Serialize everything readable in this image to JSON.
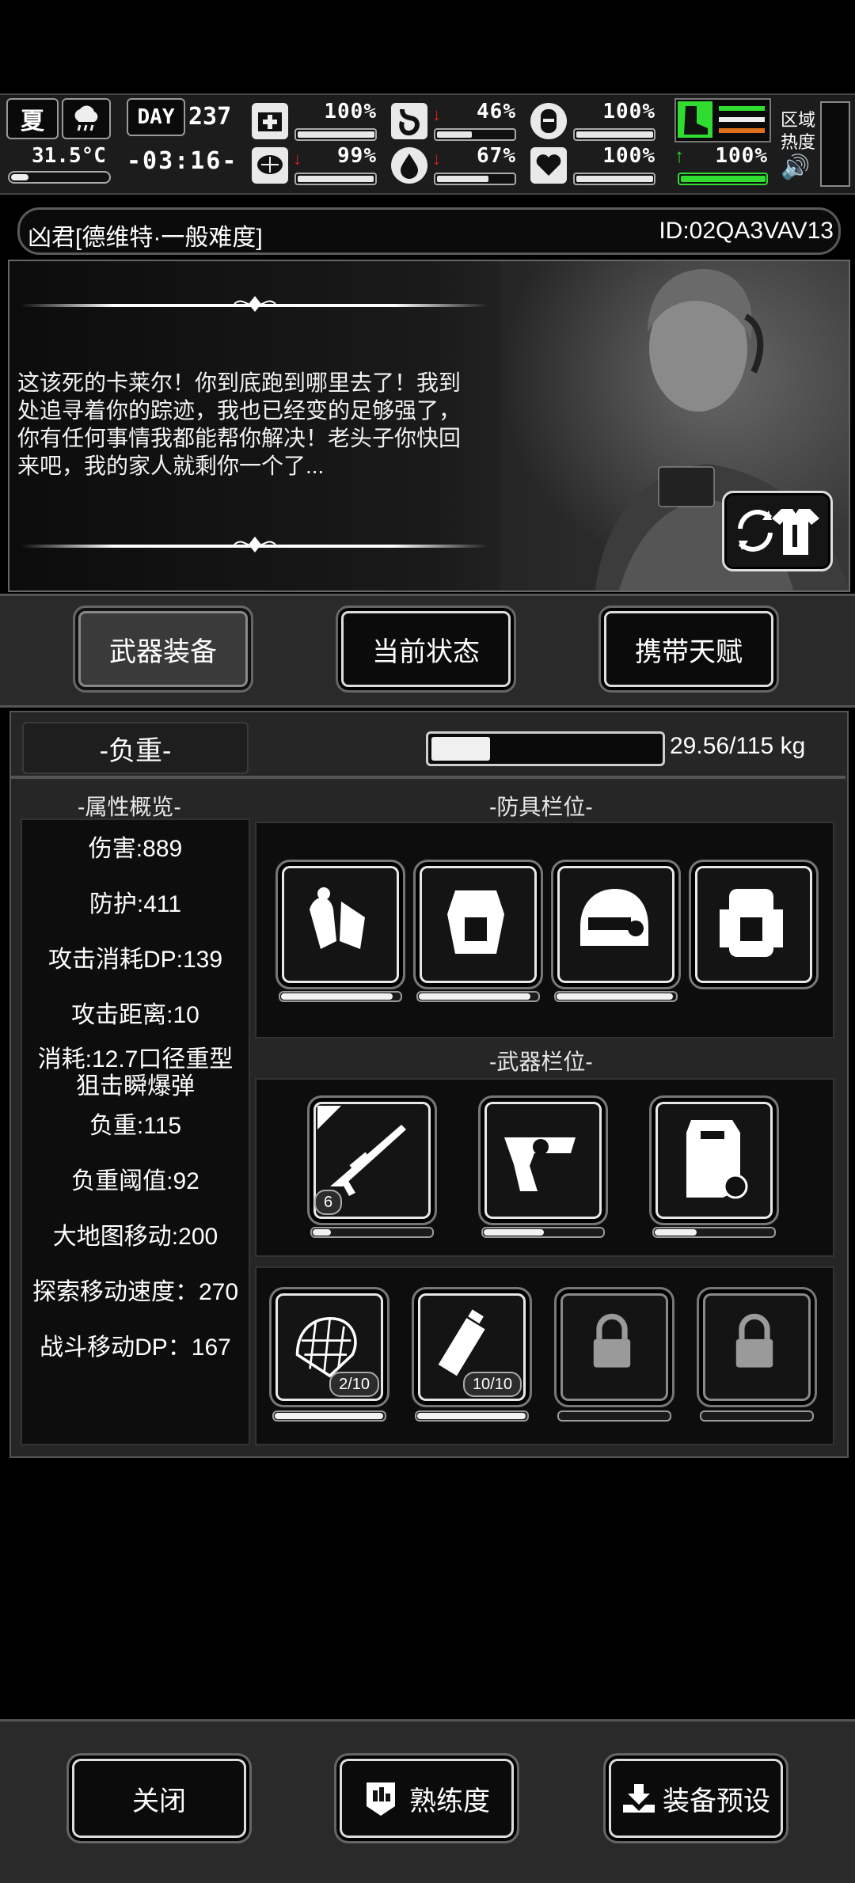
{
  "hud": {
    "season": "夏",
    "day_label": "DAY",
    "day_number": "237",
    "temperature": "31.5°C",
    "time": "-03:16-",
    "stats": [
      {
        "name": "health",
        "value": "100%",
        "percent": 100,
        "arrow": ""
      },
      {
        "name": "hunger",
        "value": "46%",
        "percent": 46,
        "arrow": "down"
      },
      {
        "name": "armor",
        "value": "100%",
        "percent": 100,
        "arrow": ""
      },
      {
        "name": "sanity",
        "value": "99%",
        "percent": 99,
        "arrow": "down"
      },
      {
        "name": "thirst",
        "value": "67%",
        "percent": 67,
        "arrow": "down"
      },
      {
        "name": "heart",
        "value": "100%",
        "percent": 100,
        "arrow": ""
      },
      {
        "name": "stamina",
        "value": "100%",
        "percent": 100,
        "arrow": "up"
      }
    ],
    "region_label_1": "区域",
    "region_label_2": "热度"
  },
  "title": {
    "name": "凶君[德维特·一般难度]",
    "id": "ID:02QA3VAV13"
  },
  "story": {
    "text": "这该死的卡莱尔！你到底跑到哪里去了！我到处追寻着你的踪迹，我也已经变的足够强了，你有任何事情我都能帮你解决！老头子你快回来吧，我的家人就剩你一个了..."
  },
  "tabs": [
    "武器装备",
    "当前状态",
    "携带天赋"
  ],
  "load": {
    "label": "-负重-",
    "text": "29.56/115 kg",
    "fraction": 0.257
  },
  "attributes": {
    "header": "-属性概览-",
    "items": [
      "伤害:889",
      "防护:411",
      "攻击消耗DP:139",
      "攻击距离:10",
      "消耗:12.7口径重型",
      "狙击瞬爆弹",
      "负重:115",
      "负重阈值:92",
      "大地图移动:200",
      "探索移动速度：270",
      "战斗移动DP：167"
    ]
  },
  "armor_slots": {
    "header": "-防具栏位-",
    "items": [
      {
        "icon": "gloves-icon",
        "durability": 0.95
      },
      {
        "icon": "armor-vest-icon",
        "durability": 0.95
      },
      {
        "icon": "helmet-icon",
        "durability": 0.98
      },
      {
        "icon": "backpack-icon",
        "durability": null
      }
    ]
  },
  "weapon_slots": {
    "header": "-武器栏位-",
    "items": [
      {
        "icon": "sniper-rifle-icon",
        "durability": 0.15,
        "badge": "6"
      },
      {
        "icon": "revolver-icon",
        "durability": 0.5,
        "badge": ""
      },
      {
        "icon": "riot-shield-icon",
        "durability": 0.35,
        "badge": ""
      }
    ]
  },
  "item_slots": {
    "items": [
      {
        "icon": "net-icon",
        "badge": "2/10",
        "durability": 1.0
      },
      {
        "icon": "canister-icon",
        "badge": "10/10",
        "durability": 1.0
      },
      {
        "icon": "lock-icon",
        "badge": "",
        "durability": 0
      },
      {
        "icon": "lock-icon",
        "badge": "",
        "durability": 0
      }
    ]
  },
  "bottom_buttons": [
    "关闭",
    "熟练度",
    "装备预设"
  ],
  "colors": {
    "stamina_green": "#2fdc2f",
    "arrow_red": "#e02020",
    "heat_orange": "#e0701a"
  }
}
